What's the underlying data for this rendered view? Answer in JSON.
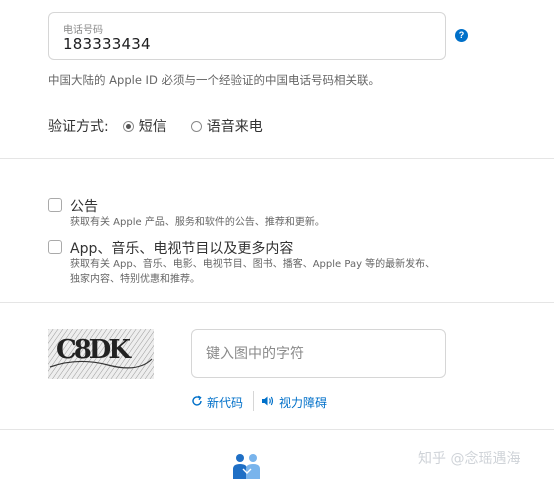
{
  "phone": {
    "label": "电话号码",
    "value": "183333434",
    "help_icon": "help-question-icon"
  },
  "phone_note": "中国大陆的 Apple ID 必须与一个经验证的中国电话号码相关联。",
  "verification": {
    "label": "验证方式:",
    "options": [
      {
        "label": "短信",
        "selected": true
      },
      {
        "label": "语音来电",
        "selected": false
      }
    ]
  },
  "subscriptions": [
    {
      "title": "公告",
      "description_lines": [
        "获取有关 Apple 产品、服务和软件的公告、推荐和更新。"
      ],
      "checked": false
    },
    {
      "title": "App、音乐、电视节目以及更多内容",
      "description_lines": [
        "获取有关 App、音乐、电影、电视节目、图书、播客、Apple Pay 等的最新发布、",
        "独家内容、特别优惠和推荐。"
      ],
      "checked": false
    }
  ],
  "captcha": {
    "image_text": "C8DK",
    "placeholder": "键入图中的字符",
    "new_code_label": "新代码",
    "new_code_icon": "refresh-icon",
    "audio_label": "视力障碍",
    "audio_icon": "speaker-icon"
  },
  "footer_icon": "people-icon",
  "watermark": "知乎 @念瑶遇海",
  "colors": {
    "accent": "#0070c9",
    "border": "#d6d6d6",
    "divider": "#e5e5e5",
    "text": "#333333",
    "muted": "#666666"
  }
}
